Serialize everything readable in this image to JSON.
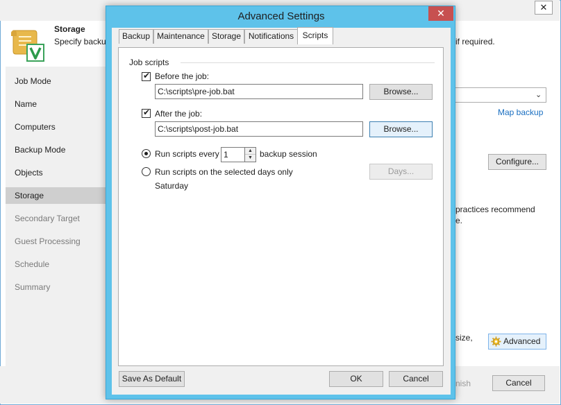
{
  "background_window": {
    "header": {
      "title": "Storage",
      "description": "Specify backu",
      "description_right": "if required."
    },
    "sidebar": {
      "items": [
        {
          "label": "Job Mode",
          "state": "normal"
        },
        {
          "label": "Name",
          "state": "normal"
        },
        {
          "label": "Computers",
          "state": "normal"
        },
        {
          "label": "Backup Mode",
          "state": "normal"
        },
        {
          "label": "Objects",
          "state": "normal"
        },
        {
          "label": "Storage",
          "state": "selected"
        },
        {
          "label": "Secondary Target",
          "state": "disabled"
        },
        {
          "label": "Guest Processing",
          "state": "disabled"
        },
        {
          "label": "Schedule",
          "state": "disabled"
        },
        {
          "label": "Summary",
          "state": "disabled"
        }
      ]
    },
    "map_backup_link": "Map backup",
    "configure_button": "Configure...",
    "text_line1": "practices recommend",
    "text_line2": "e.",
    "text_line3": "size,",
    "advanced_button": "Advanced",
    "finish_button": "nish",
    "cancel_button": "Cancel",
    "close_glyph": "✕"
  },
  "dialog": {
    "title": "Advanced Settings",
    "close_glyph": "✕",
    "tabs": [
      {
        "label": "Backup"
      },
      {
        "label": "Maintenance"
      },
      {
        "label": "Storage"
      },
      {
        "label": "Notifications"
      },
      {
        "label": "Scripts",
        "active": true
      }
    ],
    "group_label": "Job scripts",
    "before_job": {
      "label": "Before the job:",
      "checked": true,
      "path": "C:\\scripts\\pre-job.bat",
      "browse": "Browse..."
    },
    "after_job": {
      "label": "After the job:",
      "checked": true,
      "path": "C:\\scripts\\post-job.bat",
      "browse": "Browse..."
    },
    "run_every": {
      "label": "Run scripts every",
      "value": "1",
      "suffix": "backup session",
      "selected": true
    },
    "run_days": {
      "label": "Run scripts on the selected days only",
      "days_button": "Days...",
      "days_value": "Saturday",
      "selected": false
    },
    "footer": {
      "save_default": "Save As Default",
      "ok": "OK",
      "cancel": "Cancel"
    }
  },
  "colors": {
    "dialog_frame": "#5ec2ea",
    "close_button": "#c75050",
    "link": "#1a6fc1"
  }
}
